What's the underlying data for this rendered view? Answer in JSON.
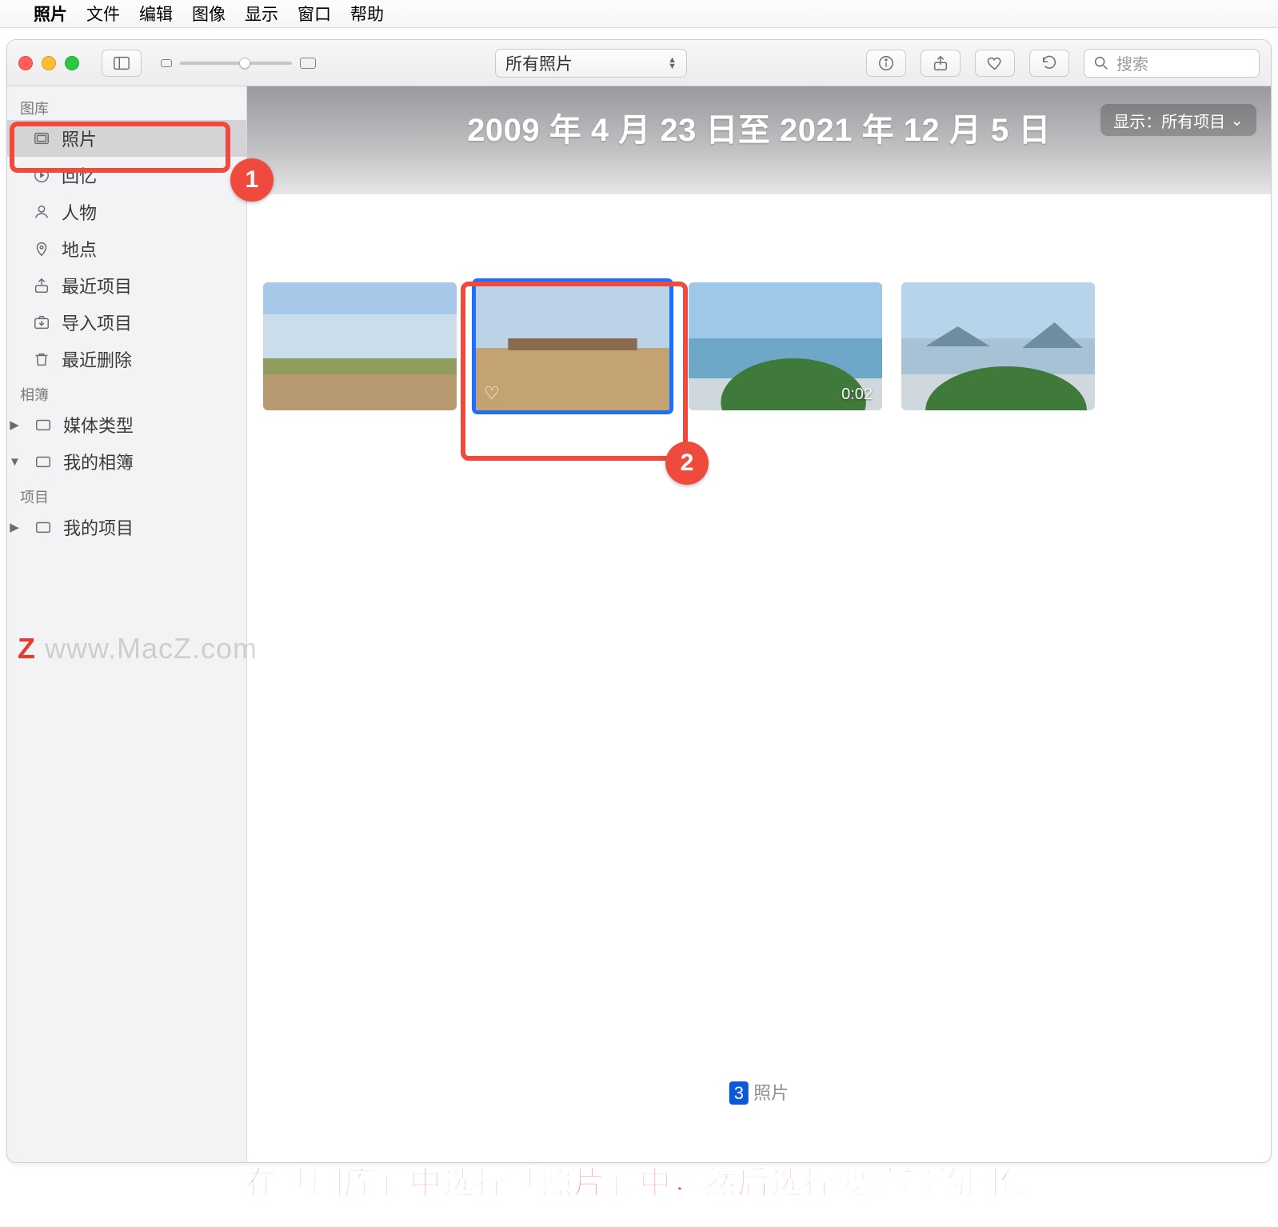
{
  "menubar": {
    "app": "照片",
    "items": [
      "文件",
      "编辑",
      "图像",
      "显示",
      "窗口",
      "帮助"
    ]
  },
  "toolbar": {
    "filter_label": "所有照片",
    "search_placeholder": "搜索"
  },
  "sidebar": {
    "section_library": "图库",
    "library_items": [
      {
        "label": "照片",
        "icon": "photos-icon",
        "selected": true
      },
      {
        "label": "回忆",
        "icon": "memories-icon",
        "selected": false
      },
      {
        "label": "人物",
        "icon": "people-icon",
        "selected": false
      },
      {
        "label": "地点",
        "icon": "places-icon",
        "selected": false
      },
      {
        "label": "最近项目",
        "icon": "recents-icon",
        "selected": false
      },
      {
        "label": "导入项目",
        "icon": "imports-icon",
        "selected": false
      },
      {
        "label": "最近删除",
        "icon": "trash-icon",
        "selected": false
      }
    ],
    "section_albums": "相簿",
    "albums_items": [
      {
        "label": "媒体类型",
        "expanded": false
      },
      {
        "label": "我的相簿",
        "expanded": true
      }
    ],
    "section_projects": "项目",
    "projects_items": [
      {
        "label": "我的项目",
        "expanded": false
      }
    ]
  },
  "header": {
    "date_range": "2009 年 4 月 23 日至 2021 年 12 月 5 日",
    "show_label": "显示：所有项目"
  },
  "thumbnails": [
    {
      "kind": "photo",
      "selected": false,
      "favorite": false,
      "duration": null
    },
    {
      "kind": "photo",
      "selected": true,
      "favorite": true,
      "duration": null
    },
    {
      "kind": "video",
      "selected": false,
      "favorite": false,
      "duration": "0:02"
    },
    {
      "kind": "photo",
      "selected": false,
      "favorite": false,
      "duration": null
    }
  ],
  "footer": {
    "count_prefix": "3",
    "count_suffix": "照片"
  },
  "annotations": {
    "badge1": "1",
    "badge2": "2",
    "caption": "在「图库」中选择「照片」中，然后选择要编辑的图像",
    "watermark": "www.MacZ.com"
  }
}
